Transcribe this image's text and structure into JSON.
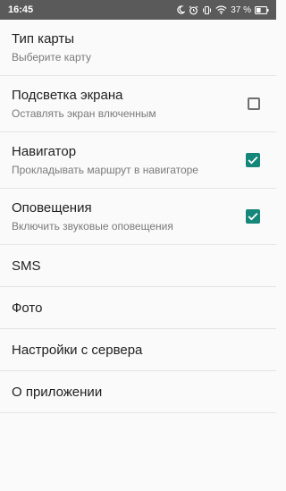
{
  "status": {
    "time": "16:45",
    "battery_text": "37 %",
    "icons": [
      "moon-icon",
      "alarm-icon",
      "vibrate-icon",
      "wifi-icon",
      "battery-icon"
    ]
  },
  "settings": {
    "map_type": {
      "title": "Тип карты",
      "subtitle": "Выберите карту"
    },
    "screen_light": {
      "title": "Подсветка экрана",
      "subtitle": "Оставлять экран влюченным",
      "checked": false
    },
    "navigator": {
      "title": "Навигатор",
      "subtitle": "Прокладывать маршрут в навигаторе",
      "checked": true
    },
    "notifications": {
      "title": "Оповещения",
      "subtitle": "Включить звуковые оповещения",
      "checked": true
    },
    "sms": {
      "title": "SMS"
    },
    "photo": {
      "title": "Фото"
    },
    "server_settings": {
      "title": "Настройки с сервера"
    },
    "about": {
      "title": "О приложении"
    }
  },
  "colors": {
    "accent": "#15867a",
    "statusbar": "#5a5a5a",
    "background": "#fafafa",
    "divider": "#e4e4e4"
  }
}
